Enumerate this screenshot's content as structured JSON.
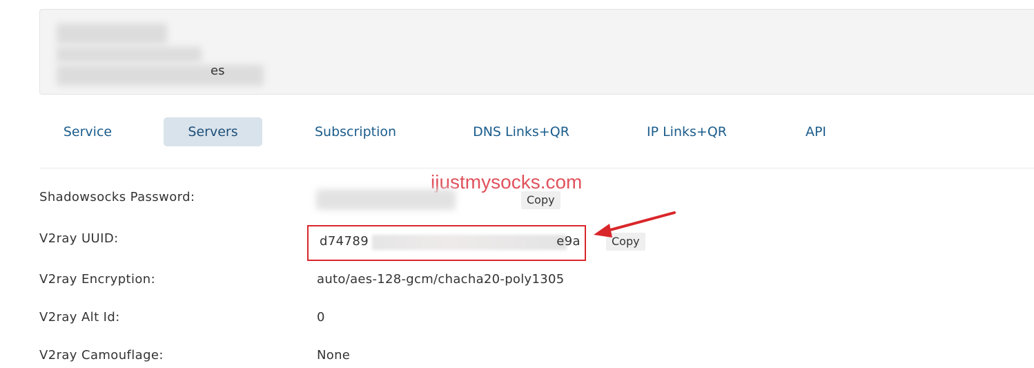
{
  "header": {
    "suffix_text": "es"
  },
  "tabs": [
    {
      "label": "Service"
    },
    {
      "label": "Servers",
      "active": true
    },
    {
      "label": "Subscription"
    },
    {
      "label": "DNS Links+QR"
    },
    {
      "label": "IP Links+QR"
    },
    {
      "label": "API"
    }
  ],
  "watermark": "ijustmysocks.com",
  "rows": {
    "password": {
      "label": "Shadowsocks Password:",
      "copy_label": "Copy"
    },
    "uuid": {
      "label": "V2ray UUID:",
      "value_start": "d74789",
      "value_end": "e9a",
      "copy_label": "Copy"
    },
    "encryption": {
      "label": "V2ray Encryption:",
      "value": "auto/aes-128-gcm/chacha20-poly1305"
    },
    "alt_id": {
      "label": "V2ray Alt Id:",
      "value": "0"
    },
    "camouflage": {
      "label": "V2ray Camouflage:",
      "value": "None"
    }
  },
  "colors": {
    "tab_text": "#1a5c8c",
    "tab_active_bg": "#d9e3ec",
    "highlight_red": "#d9262a",
    "watermark": "#e0525c"
  }
}
